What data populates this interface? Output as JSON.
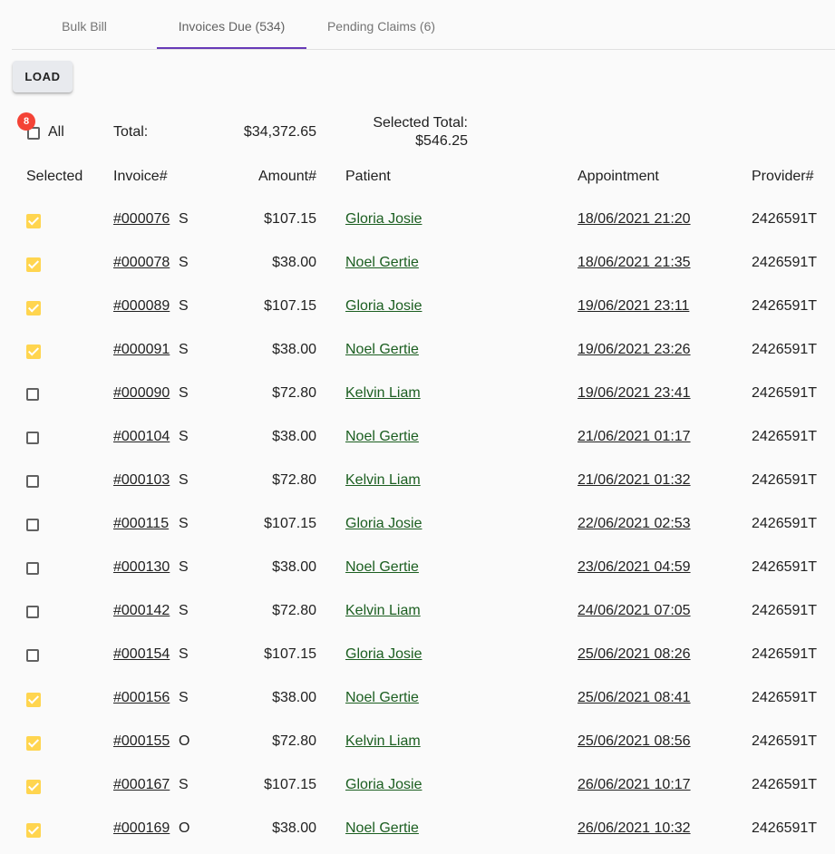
{
  "tabs": [
    {
      "label": "Bulk Bill",
      "active": false
    },
    {
      "label": "Invoices Due (534)",
      "active": true
    },
    {
      "label": "Pending Claims (6)",
      "active": false
    }
  ],
  "toolbar": {
    "load_label": "LOAD"
  },
  "summary": {
    "badge_count": "8",
    "all_label": "All",
    "total_label": "Total:",
    "total_value": "$34,372.65",
    "selected_total_label": "Selected Total:",
    "selected_total_value": "$546.25"
  },
  "columns": {
    "selected": "Selected",
    "invoice": "Invoice#",
    "amount": "Amount#",
    "patient": "Patient",
    "appointment": "Appointment",
    "provider": "Provider#"
  },
  "colors": {
    "accent": "#673ab7",
    "checkbox_checked": "#ffd54f",
    "badge": "#f44336",
    "patient_link": "#1b5e20"
  },
  "rows": [
    {
      "selected": true,
      "invoice": "#000076",
      "type": "S",
      "amount": "$107.15",
      "patient": "Gloria Josie",
      "appointment": "18/06/2021 21:20",
      "provider": "2426591T"
    },
    {
      "selected": true,
      "invoice": "#000078",
      "type": "S",
      "amount": "$38.00",
      "patient": "Noel Gertie",
      "appointment": "18/06/2021 21:35",
      "provider": "2426591T"
    },
    {
      "selected": true,
      "invoice": "#000089",
      "type": "S",
      "amount": "$107.15",
      "patient": "Gloria Josie",
      "appointment": "19/06/2021 23:11",
      "provider": "2426591T"
    },
    {
      "selected": true,
      "invoice": "#000091",
      "type": "S",
      "amount": "$38.00",
      "patient": "Noel Gertie",
      "appointment": "19/06/2021 23:26",
      "provider": "2426591T"
    },
    {
      "selected": false,
      "invoice": "#000090",
      "type": "S",
      "amount": "$72.80",
      "patient": "Kelvin Liam",
      "appointment": "19/06/2021 23:41",
      "provider": "2426591T"
    },
    {
      "selected": false,
      "invoice": "#000104",
      "type": "S",
      "amount": "$38.00",
      "patient": "Noel Gertie",
      "appointment": "21/06/2021 01:17",
      "provider": "2426591T"
    },
    {
      "selected": false,
      "invoice": "#000103",
      "type": "S",
      "amount": "$72.80",
      "patient": "Kelvin Liam",
      "appointment": "21/06/2021 01:32",
      "provider": "2426591T"
    },
    {
      "selected": false,
      "invoice": "#000115",
      "type": "S",
      "amount": "$107.15",
      "patient": "Gloria Josie",
      "appointment": "22/06/2021 02:53",
      "provider": "2426591T"
    },
    {
      "selected": false,
      "invoice": "#000130",
      "type": "S",
      "amount": "$38.00",
      "patient": "Noel Gertie",
      "appointment": "23/06/2021 04:59",
      "provider": "2426591T"
    },
    {
      "selected": false,
      "invoice": "#000142",
      "type": "S",
      "amount": "$72.80",
      "patient": "Kelvin Liam",
      "appointment": "24/06/2021 07:05",
      "provider": "2426591T"
    },
    {
      "selected": false,
      "invoice": "#000154",
      "type": "S",
      "amount": "$107.15",
      "patient": "Gloria Josie",
      "appointment": "25/06/2021 08:26",
      "provider": "2426591T"
    },
    {
      "selected": true,
      "invoice": "#000156",
      "type": "S",
      "amount": "$38.00",
      "patient": "Noel Gertie",
      "appointment": "25/06/2021 08:41",
      "provider": "2426591T"
    },
    {
      "selected": true,
      "invoice": "#000155",
      "type": "O",
      "amount": "$72.80",
      "patient": "Kelvin Liam",
      "appointment": "25/06/2021 08:56",
      "provider": "2426591T"
    },
    {
      "selected": true,
      "invoice": "#000167",
      "type": "S",
      "amount": "$107.15",
      "patient": "Gloria Josie",
      "appointment": "26/06/2021 10:17",
      "provider": "2426591T"
    },
    {
      "selected": true,
      "invoice": "#000169",
      "type": "O",
      "amount": "$38.00",
      "patient": "Noel Gertie",
      "appointment": "26/06/2021 10:32",
      "provider": "2426591T"
    }
  ]
}
